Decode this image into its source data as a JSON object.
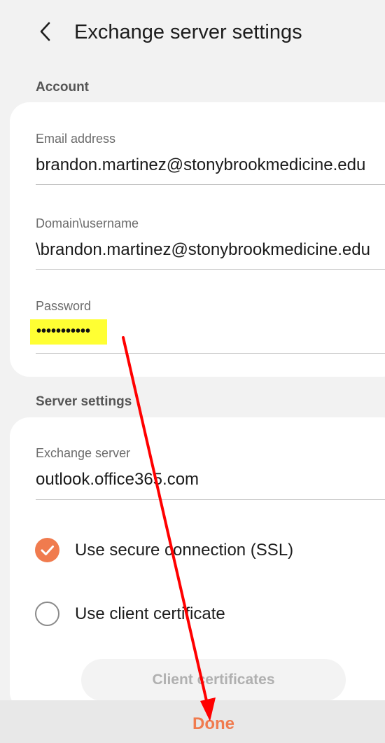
{
  "header": {
    "title": "Exchange server settings",
    "back_icon": "chevron-left-icon"
  },
  "account": {
    "section_label": "Account",
    "email": {
      "label": "Email address",
      "value": "brandon.martinez@stonybrookmedicine.edu"
    },
    "domain_username": {
      "label": "Domain\\username",
      "value": "\\brandon.martinez@stonybrookmedicine.edu"
    },
    "password": {
      "label": "Password",
      "value": "•••••••••••",
      "highlight_color": "#ffff33"
    }
  },
  "server": {
    "section_label": "Server settings",
    "exchange_server": {
      "label": "Exchange server",
      "value": "outlook.office365.com"
    },
    "ssl": {
      "label": "Use secure connection (SSL)",
      "checked": true
    },
    "client_cert": {
      "label": "Use client certificate",
      "checked": false
    },
    "client_certificates_button": "Client certificates"
  },
  "footer": {
    "done_label": "Done"
  },
  "colors": {
    "accent": "#f07b4e",
    "annotation_arrow": "#ff0000"
  }
}
